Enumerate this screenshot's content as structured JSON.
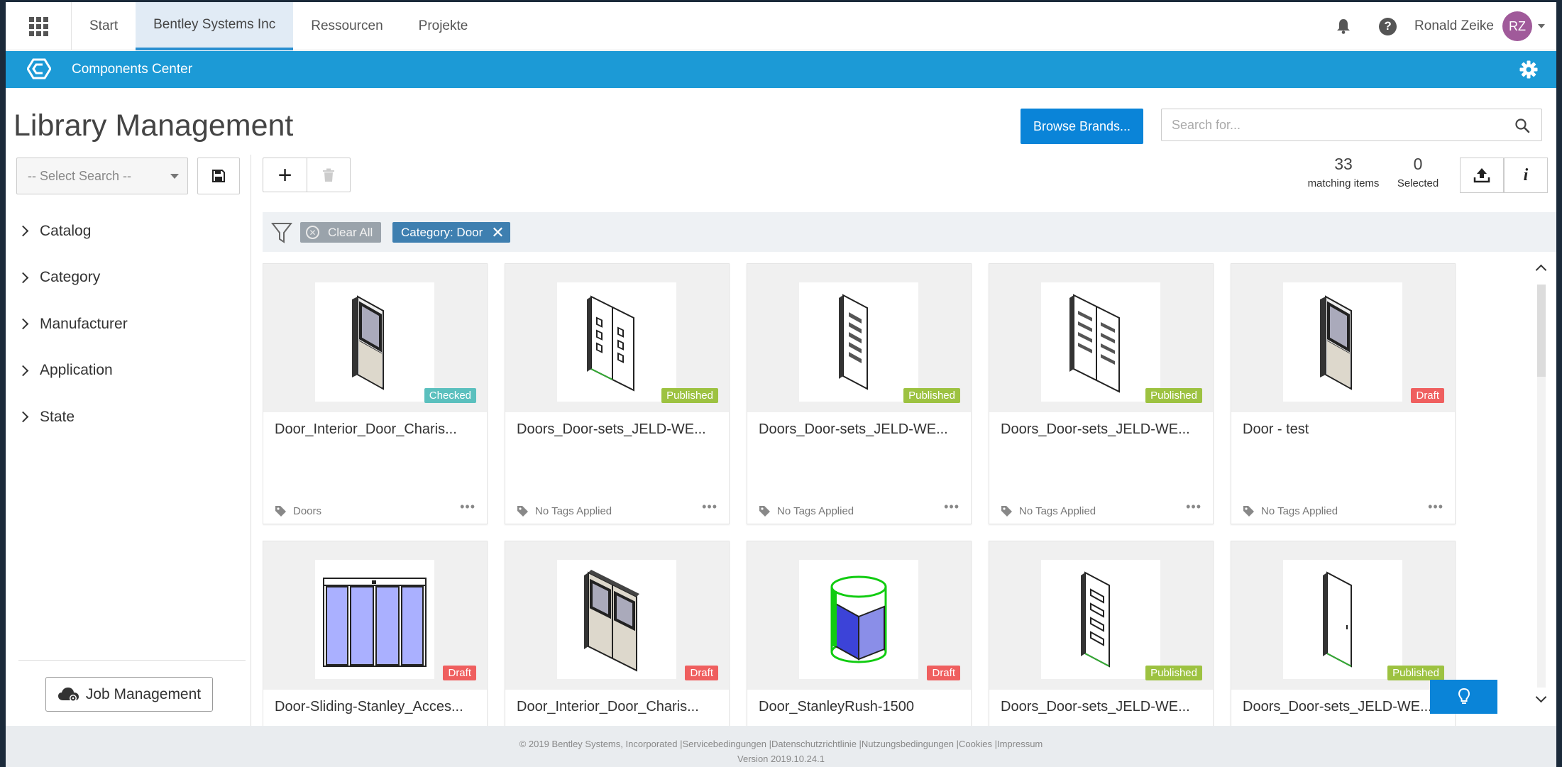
{
  "topnav": {
    "tabs": [
      {
        "label": "Start"
      },
      {
        "label": "Bentley Systems Inc"
      },
      {
        "label": "Ressourcen"
      },
      {
        "label": "Projekte"
      }
    ],
    "help_glyph": "?",
    "user_name": "Ronald Zeike",
    "avatar_initials": "RZ"
  },
  "appbar": {
    "title": "Components Center"
  },
  "page": {
    "title": "Library Management",
    "browse_label": "Browse Brands...",
    "search_placeholder": "Search for..."
  },
  "sidebar": {
    "select_search": "-- Select Search --",
    "facets": [
      {
        "label": "Catalog"
      },
      {
        "label": "Category"
      },
      {
        "label": "Manufacturer"
      },
      {
        "label": "Application"
      },
      {
        "label": "State"
      }
    ],
    "job_management": "Job Management"
  },
  "toolbar": {
    "matching_count": "33",
    "matching_label": "matching items",
    "selected_count": "0",
    "selected_label": "Selected",
    "info_glyph": "i"
  },
  "filters": {
    "clear_all": "Clear All",
    "chips": [
      {
        "label": "Category: Door"
      }
    ]
  },
  "items": [
    {
      "name": "Door_Interior_Door_Charis...",
      "status": "Checked",
      "tags": "Doors",
      "thumb": "single-door-glass"
    },
    {
      "name": "Doors_Door-sets_JELD-WE...",
      "status": "Published",
      "tags": "No Tags Applied",
      "thumb": "double-door-panels"
    },
    {
      "name": "Doors_Door-sets_JELD-WE...",
      "status": "Published",
      "tags": "No Tags Applied",
      "thumb": "single-door-slots"
    },
    {
      "name": "Doors_Door-sets_JELD-WE...",
      "status": "Published",
      "tags": "No Tags Applied",
      "thumb": "double-door-slots"
    },
    {
      "name": "Door - test",
      "status": "Draft",
      "tags": "No Tags Applied",
      "thumb": "single-door-glass"
    },
    {
      "name": "Door-Sliding-Stanley_Acces...",
      "status": "Draft",
      "tags": "",
      "thumb": "sliding-door"
    },
    {
      "name": "Door_Interior_Door_Charis...",
      "status": "Draft",
      "tags": "",
      "thumb": "double-door-glass"
    },
    {
      "name": "Door_StanleyRush-1500",
      "status": "Draft",
      "tags": "",
      "thumb": "revolving-door"
    },
    {
      "name": "Doors_Door-sets_JELD-WE...",
      "status": "Published",
      "tags": "",
      "thumb": "single-door-panels"
    },
    {
      "name": "Doors_Door-sets_JELD-WE...",
      "status": "Published",
      "tags": "",
      "thumb": "single-door-plain"
    }
  ],
  "status_colors": {
    "Checked": "#5bc0be",
    "Published": "#9dc241",
    "Draft": "#ef5f5f"
  },
  "colors": {
    "appbar": "#1c9ad6",
    "primary_button": "#0a84d8",
    "filter_chip": "#3e7fb0",
    "avatar": "#a05a9a"
  },
  "footer": {
    "line1": "© 2019 Bentley Systems, Incorporated |Servicebedingungen |Datenschutzrichtlinie |Nutzungsbedingungen |Cookies |Impressum",
    "line2": "Version 2019.10.24.1"
  }
}
